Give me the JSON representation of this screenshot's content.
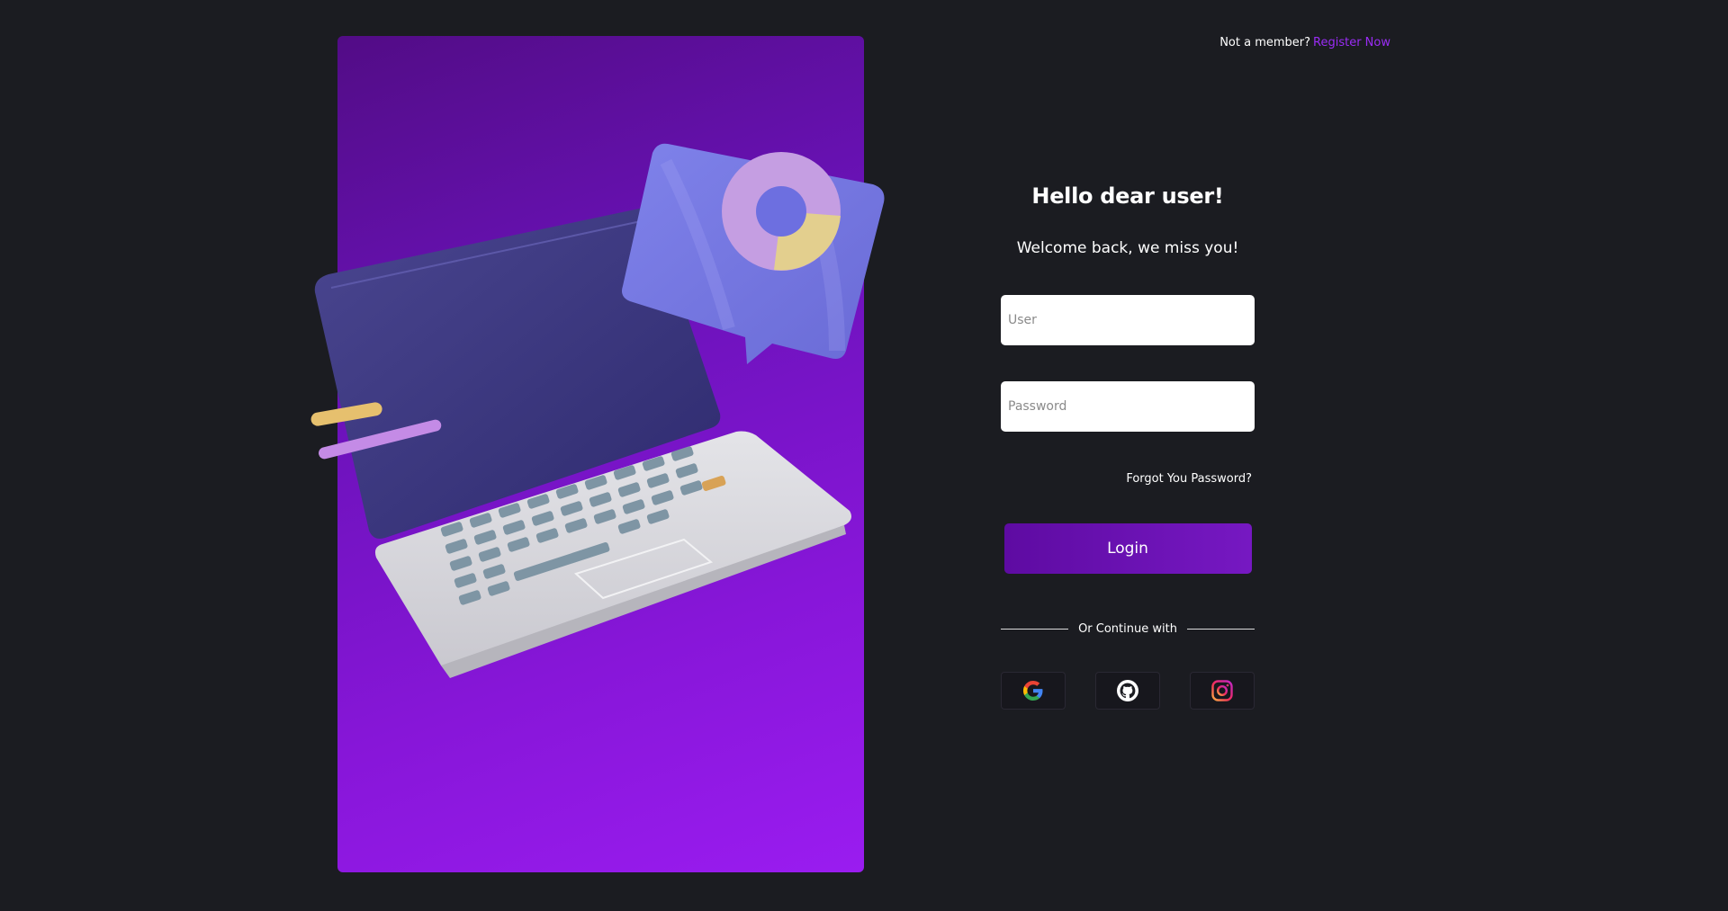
{
  "header": {
    "prompt_text": "Not a member?",
    "register_link": "Register Now"
  },
  "form": {
    "title": "Hello dear user!",
    "subtitle": "Welcome back, we miss you!",
    "user_placeholder": "User",
    "password_placeholder": "Password",
    "forgot_label": "Forgot You Password?",
    "login_label": "Login",
    "divider_text": "Or Continue with"
  },
  "socials": [
    {
      "name": "google-icon"
    },
    {
      "name": "github-icon"
    },
    {
      "name": "instagram-icon"
    }
  ],
  "colors": {
    "background": "#1b1c21",
    "accent": "#9a2cf5",
    "button": "#6a12b8"
  }
}
